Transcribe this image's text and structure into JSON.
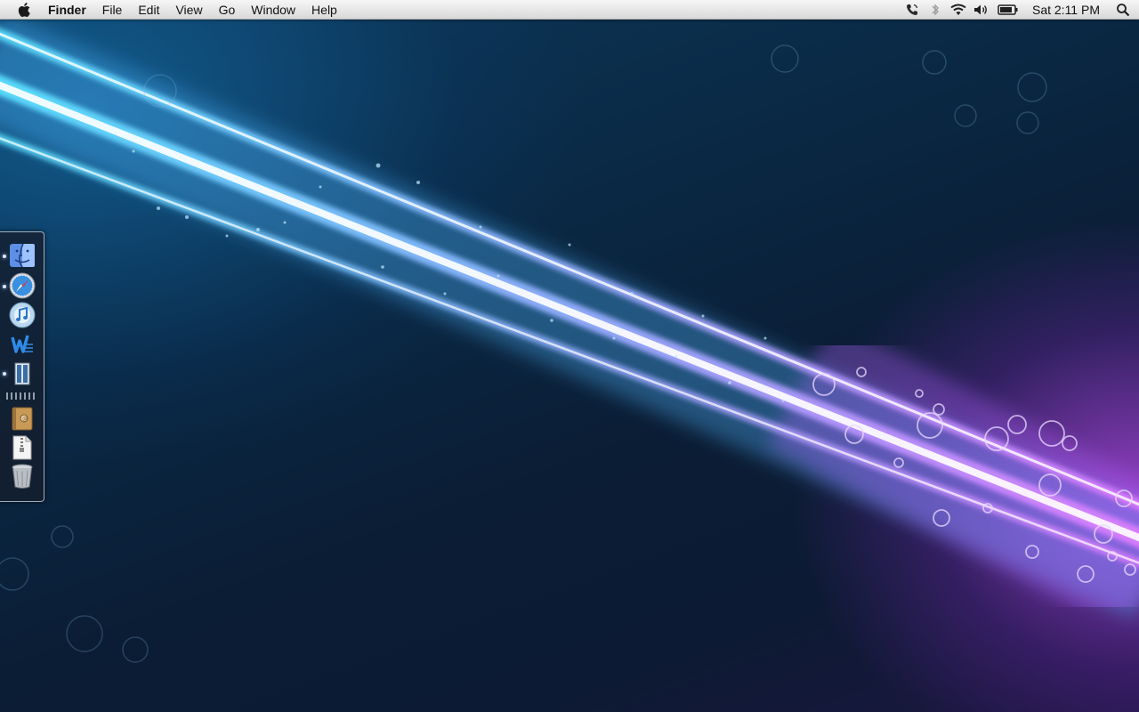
{
  "menubar": {
    "app_name": "Finder",
    "items": [
      "File",
      "Edit",
      "View",
      "Go",
      "Window",
      "Help"
    ],
    "status_icons": [
      "phone-icon",
      "bluetooth-icon",
      "wifi-icon",
      "volume-icon",
      "battery-icon"
    ],
    "clock": "Sat 2:11 PM"
  },
  "dock": {
    "items": [
      {
        "name": "finder",
        "icon": "finder-icon",
        "running": true
      },
      {
        "name": "safari",
        "icon": "safari-compass-icon",
        "running": true
      },
      {
        "name": "itunes",
        "icon": "itunes-icon",
        "running": false
      },
      {
        "name": "word",
        "icon": "word-w-icon",
        "running": false
      },
      {
        "name": "window-app",
        "icon": "window-app-icon",
        "running": true
      },
      {
        "name": "address-book",
        "icon": "address-book-icon",
        "running": false
      },
      {
        "name": "zip-archive",
        "icon": "zip-file-icon",
        "running": false
      },
      {
        "name": "trash",
        "icon": "trash-icon",
        "running": false
      }
    ]
  },
  "colors": {
    "wallpaper_dark": "#0b1d35",
    "beam_cyan": "#4fd8ff",
    "beam_purple": "#c65cf0",
    "menubar_bg": "#e6e6e6"
  }
}
